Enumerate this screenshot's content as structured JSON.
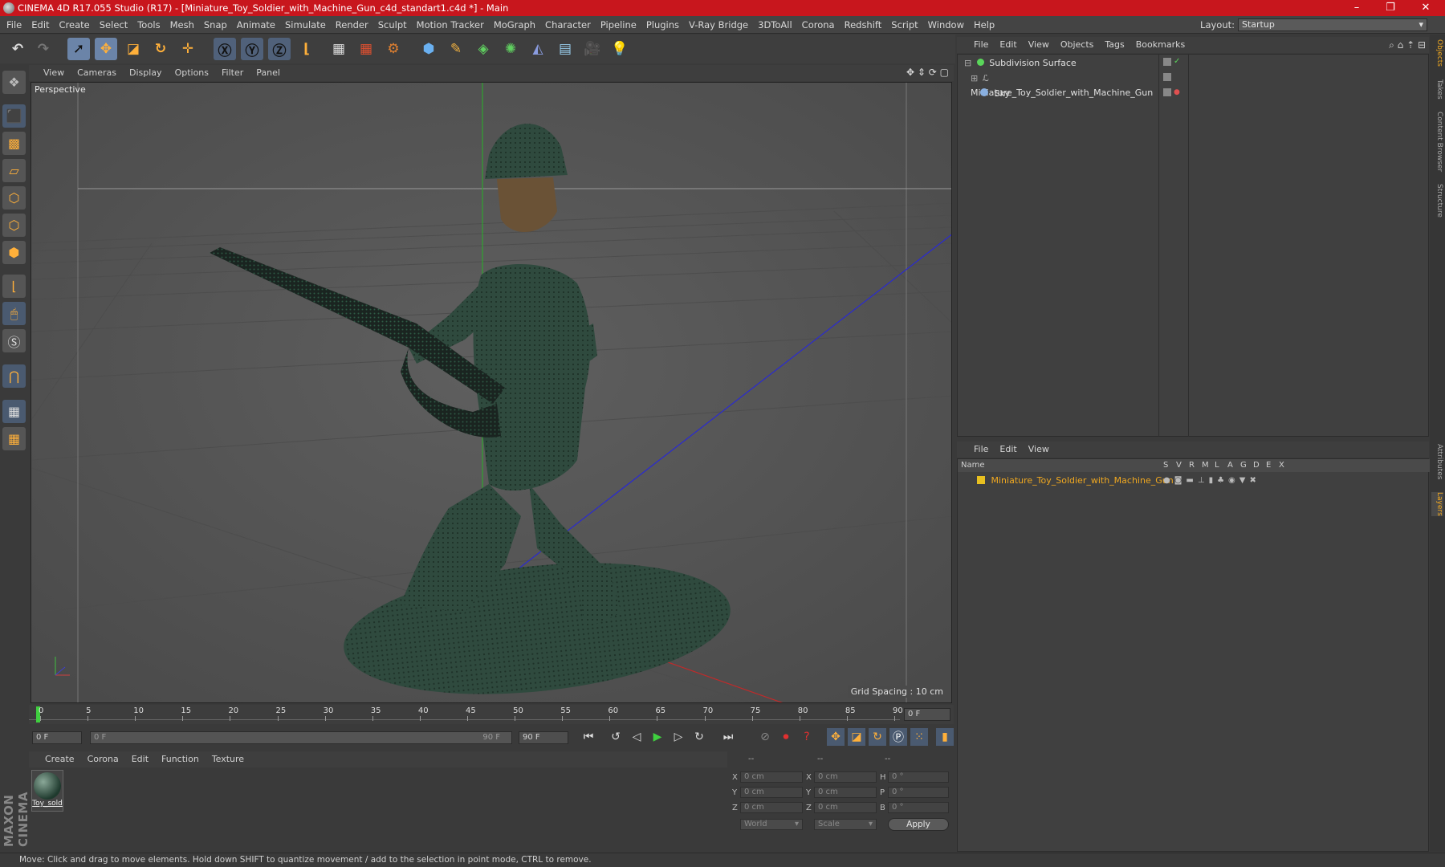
{
  "window": {
    "title": "CINEMA 4D R17.055 Studio (R17) - [Miniature_Toy_Soldier_with_Machine_Gun_c4d_standart1.c4d *] - Main",
    "minimize": "–",
    "maximize": "❐",
    "close": "✕"
  },
  "menu": [
    "File",
    "Edit",
    "Create",
    "Select",
    "Tools",
    "Mesh",
    "Snap",
    "Animate",
    "Simulate",
    "Render",
    "Sculpt",
    "Motion Tracker",
    "MoGraph",
    "Character",
    "Pipeline",
    "Plugins",
    "V-Ray Bridge",
    "3DToAll",
    "Corona",
    "Redshift",
    "Script",
    "Window",
    "Help"
  ],
  "layout": {
    "label": "Layout:",
    "value": "Startup"
  },
  "viewport": {
    "menu": [
      "View",
      "Cameras",
      "Display",
      "Options",
      "Filter",
      "Panel"
    ],
    "label": "Perspective",
    "grid_spacing": "Grid Spacing : 10 cm"
  },
  "timeline": {
    "ticks": [
      "0",
      "5",
      "10",
      "15",
      "20",
      "25",
      "30",
      "35",
      "40",
      "45",
      "50",
      "55",
      "60",
      "65",
      "70",
      "75",
      "80",
      "85",
      "90"
    ],
    "current_frame": "0 F",
    "start_field": "0 F",
    "range_start": "0 F",
    "range_end": "90 F",
    "end_field": "90 F"
  },
  "materials": {
    "menu": [
      "Create",
      "Corona",
      "Edit",
      "Function",
      "Texture"
    ],
    "items": [
      {
        "name": "Toy_sold"
      }
    ]
  },
  "coordinates": {
    "headers": [
      "--",
      "--",
      "--"
    ],
    "rows": [
      {
        "a": "X",
        "av": "0 cm",
        "b": "X",
        "bv": "0 cm",
        "c": "H",
        "cv": "0 °"
      },
      {
        "a": "Y",
        "av": "0 cm",
        "b": "Y",
        "bv": "0 cm",
        "c": "P",
        "cv": "0 °"
      },
      {
        "a": "Z",
        "av": "0 cm",
        "b": "Z",
        "bv": "0 cm",
        "c": "B",
        "cv": "0 °"
      }
    ],
    "mode": "World",
    "scale": "Scale",
    "apply": "Apply"
  },
  "objects": {
    "menu": [
      "File",
      "Edit",
      "View",
      "Objects",
      "Tags",
      "Bookmarks"
    ],
    "items": [
      {
        "name": "Subdivision Surface",
        "color": "#5ad65a"
      },
      {
        "name": "Miniature_Toy_Soldier_with_Machine_Gun",
        "color": "#aaaaaa"
      },
      {
        "name": "Sky",
        "color": "#8ab0e0"
      }
    ]
  },
  "layers": {
    "menu": [
      "File",
      "Edit",
      "View"
    ],
    "columns": [
      "Name",
      "S",
      "V",
      "R",
      "M",
      "L",
      "A",
      "G",
      "D",
      "E",
      "X"
    ],
    "items": [
      {
        "name": "Miniature_Toy_Soldier_with_Machine_Gun",
        "color": "#e8c020"
      }
    ]
  },
  "right_tabs": [
    "Objects",
    "Takes",
    "Content Browser",
    "Structure",
    "Attributes",
    "Layers"
  ],
  "status": "Move: Click and drag to move elements. Hold down SHIFT to quantize movement / add to the selection in point mode, CTRL to remove.",
  "branding": "MAXON CINEMA 4D"
}
